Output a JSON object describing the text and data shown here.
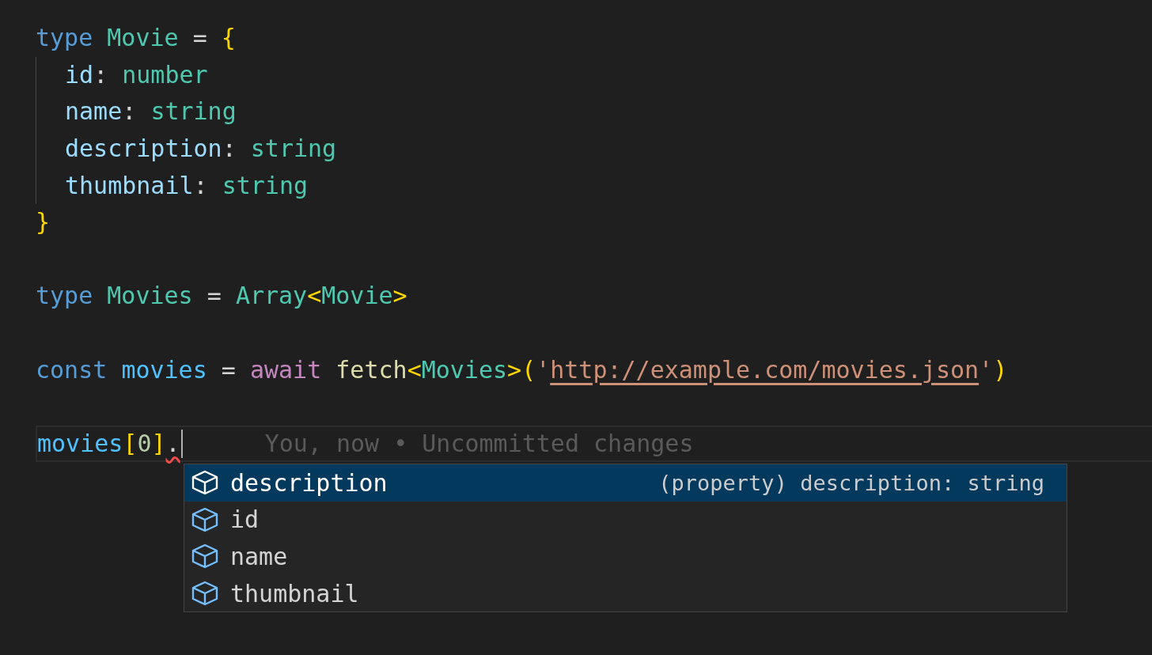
{
  "editor": {
    "lines": [
      {
        "kind": "code",
        "tokens": [
          {
            "text": "type ",
            "kind": "keyword"
          },
          {
            "text": "Movie",
            "kind": "type"
          },
          {
            "text": " = ",
            "kind": "plain"
          },
          {
            "text": "{",
            "kind": "bracket"
          }
        ],
        "children": [
          {
            "kind": "code",
            "tokens": [
              {
                "text": "id",
                "kind": "property"
              },
              {
                "text": ": ",
                "kind": "plain"
              },
              {
                "text": "number",
                "kind": "type"
              }
            ]
          },
          {
            "kind": "code",
            "tokens": [
              {
                "text": "name",
                "kind": "property"
              },
              {
                "text": ": ",
                "kind": "plain"
              },
              {
                "text": "string",
                "kind": "type"
              }
            ]
          },
          {
            "kind": "code",
            "tokens": [
              {
                "text": "description",
                "kind": "property"
              },
              {
                "text": ": ",
                "kind": "plain"
              },
              {
                "text": "string",
                "kind": "type"
              }
            ]
          },
          {
            "kind": "code",
            "tokens": [
              {
                "text": "thumbnail",
                "kind": "property"
              },
              {
                "text": ": ",
                "kind": "plain"
              },
              {
                "text": "string",
                "kind": "type"
              }
            ]
          }
        ]
      },
      {
        "kind": "code",
        "tokens": [
          {
            "text": "}",
            "kind": "bracket"
          }
        ]
      },
      {
        "kind": "blank"
      },
      {
        "kind": "code",
        "tokens": [
          {
            "text": "type ",
            "kind": "keyword"
          },
          {
            "text": "Movies",
            "kind": "type"
          },
          {
            "text": " = ",
            "kind": "plain"
          },
          {
            "text": "Array",
            "kind": "type"
          },
          {
            "text": "<",
            "kind": "bracket"
          },
          {
            "text": "Movie",
            "kind": "type"
          },
          {
            "text": ">",
            "kind": "bracket"
          }
        ]
      },
      {
        "kind": "blank"
      },
      {
        "kind": "code",
        "tokens": [
          {
            "text": "const ",
            "kind": "keyword"
          },
          {
            "text": "movies",
            "kind": "constant"
          },
          {
            "text": " = ",
            "kind": "plain"
          },
          {
            "text": "await ",
            "kind": "control"
          },
          {
            "text": "fetch",
            "kind": "function"
          },
          {
            "text": "<",
            "kind": "bracket"
          },
          {
            "text": "Movies",
            "kind": "type"
          },
          {
            "text": ">",
            "kind": "bracket"
          },
          {
            "text": "(",
            "kind": "bracket"
          },
          {
            "text": "'",
            "kind": "string"
          },
          {
            "text": "http://example.com/movies.json",
            "kind": "link"
          },
          {
            "text": "'",
            "kind": "string"
          },
          {
            "text": ")",
            "kind": "bracket"
          }
        ]
      },
      {
        "kind": "blank"
      },
      {
        "kind": "code",
        "current": true,
        "tokens": [
          {
            "text": "movies",
            "kind": "constant"
          },
          {
            "text": "[",
            "kind": "bracket"
          },
          {
            "text": "0",
            "kind": "number"
          },
          {
            "text": "]",
            "kind": "bracket"
          },
          {
            "text": ".",
            "kind": "plain",
            "error": true
          }
        ],
        "blame": "You, now • Uncommitted changes"
      }
    ]
  },
  "suggestions": [
    {
      "label": "description",
      "selected": true,
      "detail": "(property) description: string"
    },
    {
      "label": "id",
      "selected": false
    },
    {
      "label": "name",
      "selected": false
    },
    {
      "label": "thumbnail",
      "selected": false
    }
  ]
}
